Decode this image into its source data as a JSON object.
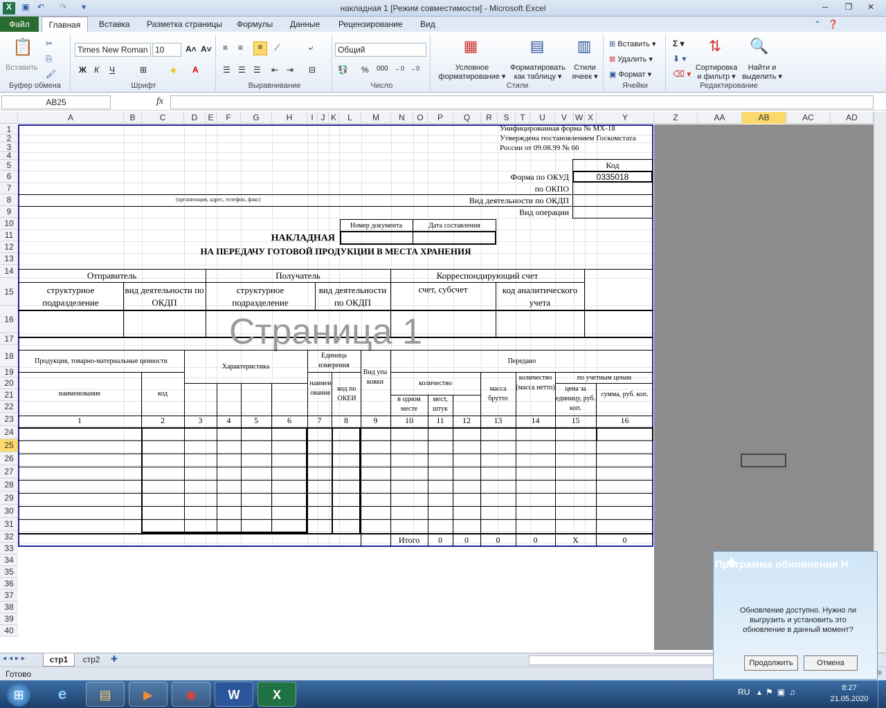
{
  "window": {
    "title": "накладная 1  [Режим совместимости]  -  Microsoft Excel",
    "minimize": "─",
    "restore": "❐",
    "close": "✕"
  },
  "ribbon": {
    "file_tab": "Файл",
    "tabs": [
      "Главная",
      "Вставка",
      "Разметка страницы",
      "Формулы",
      "Данные",
      "Рецензирование",
      "Вид"
    ],
    "clipboard": {
      "paste": "Вставить",
      "label": "Буфер обмена"
    },
    "font": {
      "name": "Times New Roman",
      "size": "10",
      "label": "Шрифт"
    },
    "alignment": {
      "label": "Выравнивание"
    },
    "number": {
      "format": "Общий",
      "label": "Число"
    },
    "styles": {
      "conditional": "Условное",
      "conditional2": "форматирование",
      "as_table": "Форматировать",
      "as_table2": "как таблицу",
      "cell_styles": "Стили",
      "cell_styles2": "ячеек",
      "label": "Стили"
    },
    "cells": {
      "insert": "Вставить",
      "delete": "Удалить",
      "format": "Формат",
      "label": "Ячейки"
    },
    "editing": {
      "sort": "Сортировка",
      "sort2": "и фильтр",
      "find": "Найти и",
      "find2": "выделить",
      "label": "Редактирование"
    }
  },
  "formula_bar": {
    "name_box": "AB25",
    "fx": "fx",
    "value": ""
  },
  "columns": [
    "A",
    "B",
    "C",
    "D",
    "E",
    "F",
    "G",
    "H",
    "I",
    "J",
    "K",
    "L",
    "M",
    "N",
    "O",
    "P",
    "Q",
    "R",
    "S",
    "T",
    "U",
    "V",
    "W",
    "X",
    "Y",
    "Z",
    "AA",
    "AB",
    "AC",
    "AD"
  ],
  "rows": [
    "1",
    "2",
    "3",
    "4",
    "5",
    "6",
    "7",
    "8",
    "9",
    "10",
    "11",
    "12",
    "13",
    "14",
    "15",
    "16",
    "17",
    "18",
    "19",
    "20",
    "21",
    "22",
    "23",
    "24",
    "25",
    "26",
    "27",
    "28",
    "29",
    "30",
    "31",
    "32",
    "33",
    "34",
    "35",
    "36",
    "37",
    "38",
    "39",
    "40"
  ],
  "form": {
    "header1": "Унифицированная форма № МХ-18",
    "header2": "Утверждена постановлением Госкомстата",
    "header3": "России от 09.08.99 № 66",
    "kod": "Код",
    "okud_label": "Форма по ОКУД",
    "okud_value": "0335018",
    "okpo": "по ОКПО",
    "org_note": "(организация, адрес, телефон, факс)",
    "okdp": "Вид деятельности по ОКДП",
    "operation": "Вид операции",
    "doc_number": "Номер документа",
    "doc_date": "Дата составления",
    "title1": "НАКЛАДНАЯ",
    "title2": "НА ПЕРЕДАЧУ ГОТОВОЙ ПРОДУКЦИИ В МЕСТА ХРАНЕНИЯ",
    "sender": "Отправитель",
    "receiver": "Получатель",
    "corr": "Корреспондирующий счет",
    "struct1": "структурное подразделение",
    "activity1": "вид деятельности по ОКДП",
    "struct2": "структурное подразделение",
    "activity2": "вид деятельности по ОКДП",
    "account": "счет, субсчет",
    "analytic": "код аналитического учета",
    "watermark": "Страница 1",
    "products": "Продукция, товарно-материальные ценности",
    "characteristic": "Характеристика",
    "unit": "Единица измерения",
    "pack": "Вид упаковки",
    "transferred": "Передано",
    "quantity": "количество",
    "name": "наименование",
    "code": "код",
    "unit_name": "наименование",
    "okei": "код по ОКЕИ",
    "per_place": "в одном месте",
    "places": "мест, штук",
    "gross": "масса брутто",
    "net": "количество (масса нетто)",
    "account_prices": "по учетным ценам",
    "unit_price": "цена за единицу, руб. коп.",
    "sum": "сумма, руб. коп.",
    "col_numbers": [
      "1",
      "2",
      "3",
      "4",
      "5",
      "6",
      "7",
      "8",
      "9",
      "10",
      "11",
      "12",
      "13",
      "14",
      "15",
      "16"
    ],
    "total": "Итого",
    "totals": [
      "0",
      "0",
      "0",
      "0",
      "X",
      "0"
    ]
  },
  "sheets": {
    "tabs": [
      "стр1",
      "стр2"
    ],
    "active": "стр1"
  },
  "status": {
    "ready": "Готово"
  },
  "taskbar": {
    "lang": "RU",
    "time": "8:27",
    "date": "21.05.2020"
  },
  "popup": {
    "title": "Программа обновления Н",
    "message": "Обновление доступно. Нужно ли выгрузить и установить это обновление в данный момент?",
    "continue": "Продолжить",
    "cancel": "Отмена"
  }
}
